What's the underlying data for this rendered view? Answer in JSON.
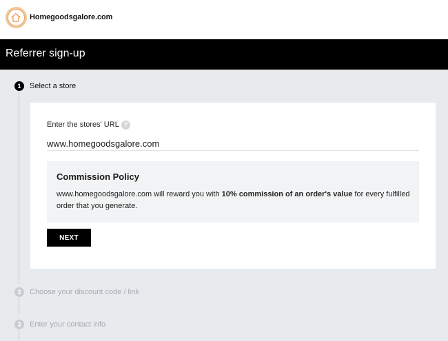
{
  "header": {
    "brand": "Homegoodsgalore.com",
    "logo_icon": "house-icon"
  },
  "title": "Referrer sign-up",
  "steps": [
    {
      "number": "1",
      "label": "Select a store",
      "state": "active"
    },
    {
      "number": "2",
      "label": "Choose your discount code / link",
      "state": "inactive"
    },
    {
      "number": "3",
      "label": "Enter your contact info",
      "state": "inactive"
    }
  ],
  "store_form": {
    "url_label": "Enter the stores' URL",
    "help_icon": "?",
    "url_value": "www.homegoodsgalore.com"
  },
  "commission_policy": {
    "heading": "Commission Policy",
    "text_before": "www.homegoodsgalore.com will reward you with ",
    "text_bold": "10% commission of an order's value",
    "text_after": " for every fulfilled order that you generate."
  },
  "actions": {
    "next_label": "NEXT"
  },
  "colors": {
    "accent": "#000000",
    "logo": "#e9a564",
    "page_background": "#e8ebee"
  }
}
